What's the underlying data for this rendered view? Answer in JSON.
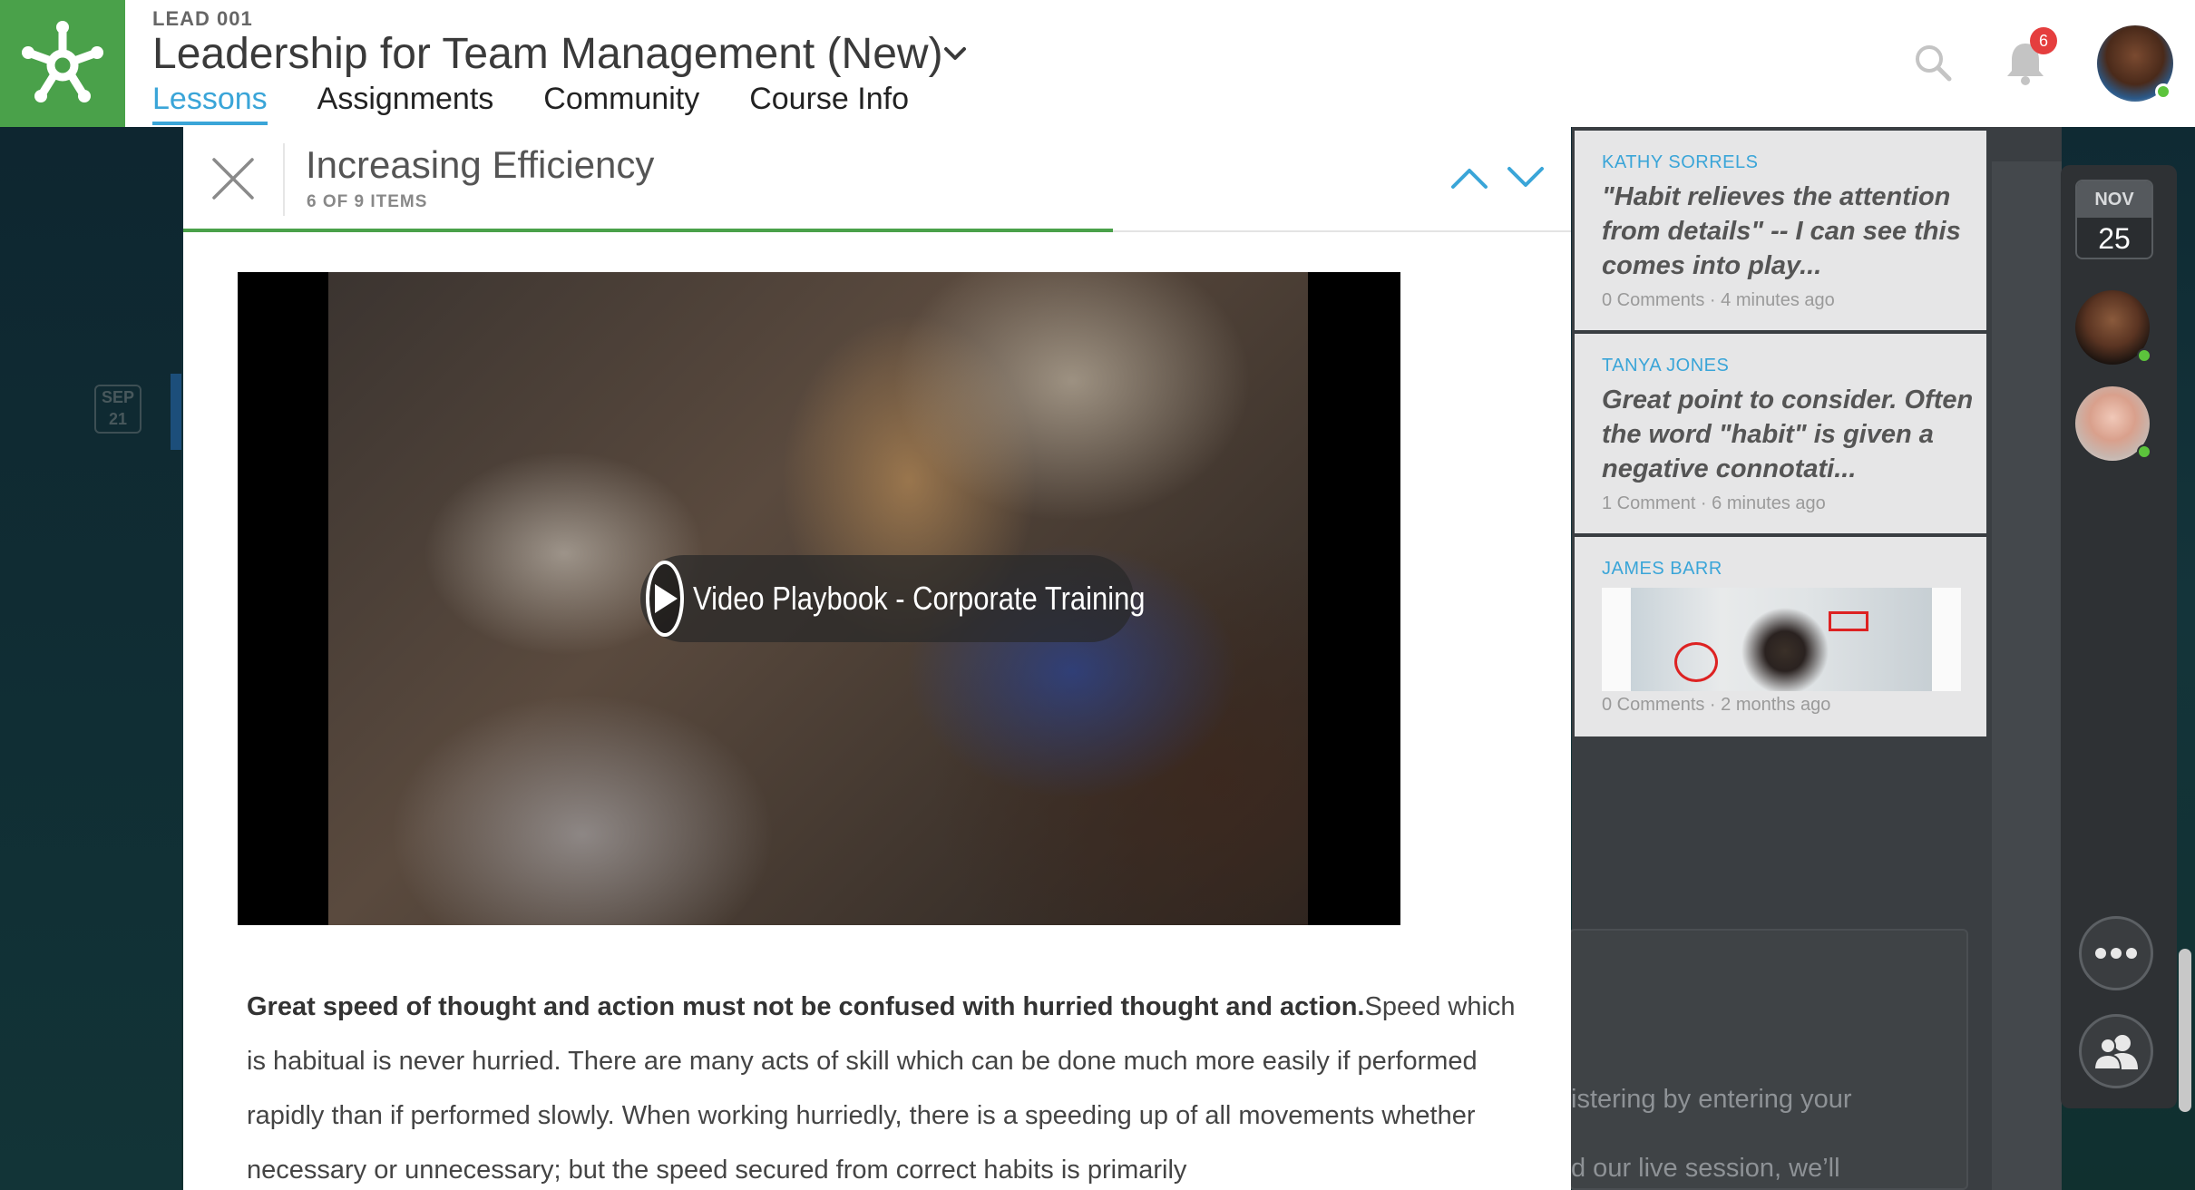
{
  "header": {
    "course_code": "LEAD 001",
    "course_title": "Leadership for Team Management (New)",
    "nav_tabs": [
      {
        "label": "Lessons",
        "active": true
      },
      {
        "label": "Assignments",
        "active": false
      },
      {
        "label": "Community",
        "active": false
      },
      {
        "label": "Course Info",
        "active": false
      }
    ],
    "notification_count": "6"
  },
  "lesson": {
    "title": "Increasing Efficiency",
    "item_count": "6 OF 9 ITEMS",
    "progress": 0.67,
    "video": {
      "label": "Video Playbook - Corporate Training"
    },
    "body_bold": "Great speed of thought and action must not be confused with hurried thought and action.",
    "body_text": "Speed which is habitual is never hurried. There are many acts of skill which can be done much more easily if performed rapidly than if performed slowly. When working hurriedly, there is a speeding up of all movements whether necessary or unnecessary; but the speed secured from correct habits is primarily"
  },
  "comments": [
    {
      "author": "KATHY SORRELS",
      "text": "\"Habit relieves the attention from details\" -- I can see this comes into play...",
      "comments_count": "0 Comments",
      "time": "4 minutes ago"
    },
    {
      "author": "TANYA JONES",
      "text": "Great point to consider. Often the word \"habit\" is given a negative connotati...",
      "comments_count": "1 Comment",
      "time": "6 minutes ago"
    },
    {
      "author": "JAMES BARR",
      "text": "",
      "comments_count": "0 Comments",
      "time": "2 months ago"
    }
  ],
  "background": {
    "left_date_month": "SEP",
    "left_date_day": "21",
    "card_line1": "istering by entering your",
    "card_line2": "d our live session, we’ll"
  },
  "rail": {
    "date_month": "NOV",
    "date_day": "25"
  },
  "colors": {
    "brand_green": "#4aa14a",
    "accent_blue": "#3aa5d8",
    "badge_red": "#e53e3e",
    "online_green": "#5cc43c"
  },
  "icons": [
    "logo-icon",
    "chevron-down-icon",
    "search-icon",
    "bell-icon",
    "close-icon",
    "chevron-up-icon",
    "play-icon",
    "more-icon",
    "people-icon"
  ]
}
